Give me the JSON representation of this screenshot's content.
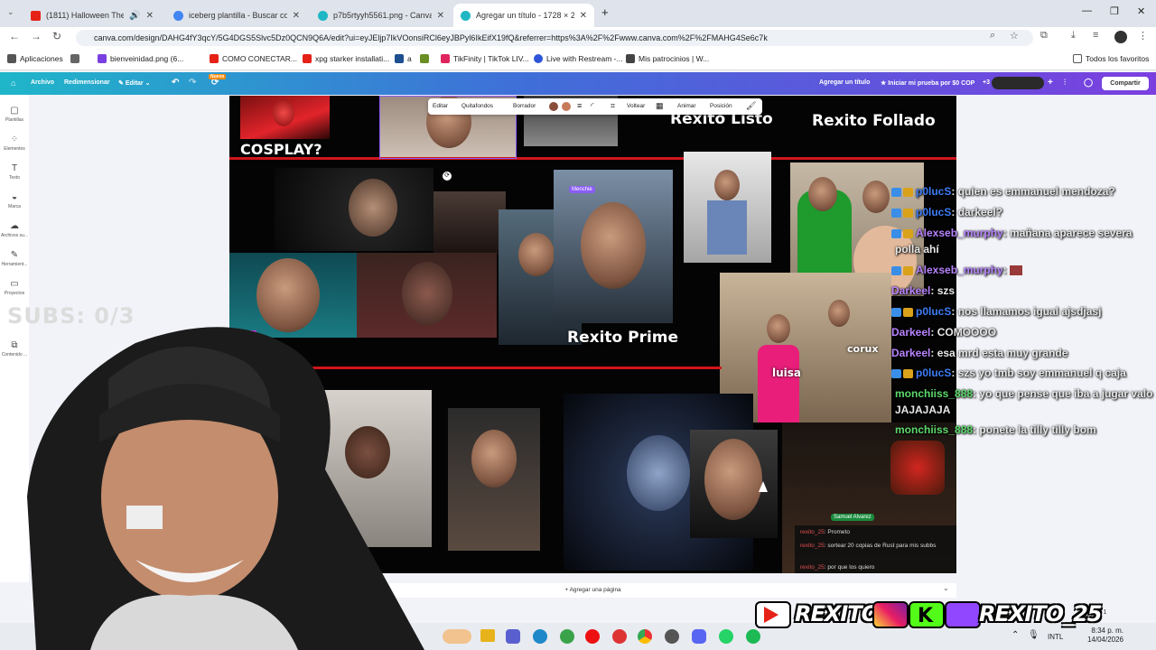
{
  "browser": {
    "tabs": [
      {
        "title": "(1811) Halloween Theme S",
        "icon": "youtube-icon",
        "color": "#e62117"
      },
      {
        "title": "iceberg plantilla - Buscar con G",
        "icon": "google-icon",
        "color": "#4285f4"
      },
      {
        "title": "p7b5rtyyh5561.png - Canva",
        "icon": "canva-icon",
        "color": "#20b7c4"
      },
      {
        "title": "Agregar un título - 1728 × 214",
        "icon": "canva-icon",
        "color": "#20b7c4"
      }
    ],
    "url": "canva.com/design/DAHG4fY3qcY/5G4DGS5Slvc5Dz0QCN9Q6A/edit?ui=eyJEljp7IkVOonsiRCl6eyJBPyl6IkEifX19fQ&referrer=https%3A%2F%2Fwww.canva.com%2F%2FMAHG4Se6c7k",
    "bookmarks": [
      "Aplicaciones",
      "bienveinidad.png (6...",
      "COMO CONECTAR...",
      "xpg starker installati...",
      "a",
      "TikFinity | TikTok LIV...",
      "Live with Restream -...",
      "Mis patrocinios | W..."
    ],
    "all_bookmarks": "Todos los favoritos"
  },
  "canva": {
    "menu": [
      "Archivo",
      "Redimensionar",
      "Editar"
    ],
    "nuevo_badge": "Nuevo",
    "title": "Agregar un título",
    "trial": "Iniciar mi prueba por $0 COP",
    "collab_count": "+3",
    "share": "Compartir",
    "sidebar": [
      "Plantillas",
      "Elementos",
      "Texto",
      "Marca",
      "Archivos su...",
      "Herramient...",
      "Proyectos",
      "Contenido ..."
    ],
    "toolbar": [
      "Editar",
      "Quitafondos",
      "Borrador",
      "Voltear",
      "Animar",
      "Posición"
    ],
    "add_page": "+ Agregar una página",
    "page_count": "1 de 1"
  },
  "design": {
    "texts": [
      "COSPLAY?",
      "Rexito Listo",
      "Rexito Follado",
      "Rexito Prime",
      "luisa",
      "corux"
    ],
    "mini_label": "Menchie",
    "samuel_label": "Samuel Alvarez",
    "inner_chat": [
      {
        "user": "rexito_25",
        "text": "Prometo"
      },
      {
        "user": "rexito_25",
        "text": "sortear 20 copias de Rust para mis subbs"
      },
      {
        "user": "rexito_25",
        "text": "por que los quiero"
      }
    ]
  },
  "overlay": {
    "subs": "SUBS: 0/3",
    "chat": [
      {
        "user": "p0lucS",
        "text": ": quien es emmanuel mendoza?",
        "cls": "n1"
      },
      {
        "user": "p0lucS",
        "text": ": darkeel?",
        "cls": "n1"
      },
      {
        "user": "Alexseb_murphy",
        "text": ": mañana aparece severa",
        "cls": "n2"
      },
      {
        "user": "",
        "text": "polla ahí",
        "cls": "m"
      },
      {
        "user": "Alexseb_murphy",
        "text": ":",
        "cls": "n2"
      },
      {
        "user": "Darkeel",
        "text": ": szs",
        "cls": "n2"
      },
      {
        "user": "p0lucS",
        "text": ": nos llamamos igual ajsdjasj",
        "cls": "n1"
      },
      {
        "user": "Darkeel",
        "text": ": COMOOOO",
        "cls": "n2"
      },
      {
        "user": "Darkeel",
        "text": ": esa mrd esta muy grande",
        "cls": "n2"
      },
      {
        "user": "p0lucS",
        "text": ": szs yo tmb soy emmanuel q caja",
        "cls": "n1"
      },
      {
        "user": "monchiiss_888",
        "text": ": yo que pense que iba a jugar valo",
        "cls": "n4"
      },
      {
        "user": "",
        "text": "JAJAJAJA",
        "cls": "m"
      },
      {
        "user": "monchiiss_888",
        "text": ": ponete la tilly tilly bom",
        "cls": "n4"
      }
    ],
    "social_1": "REXITO",
    "social_2": "REXITO_25"
  },
  "system": {
    "lang": "INTL",
    "time": "8:34 p. m.",
    "date": "14/04/2026"
  }
}
